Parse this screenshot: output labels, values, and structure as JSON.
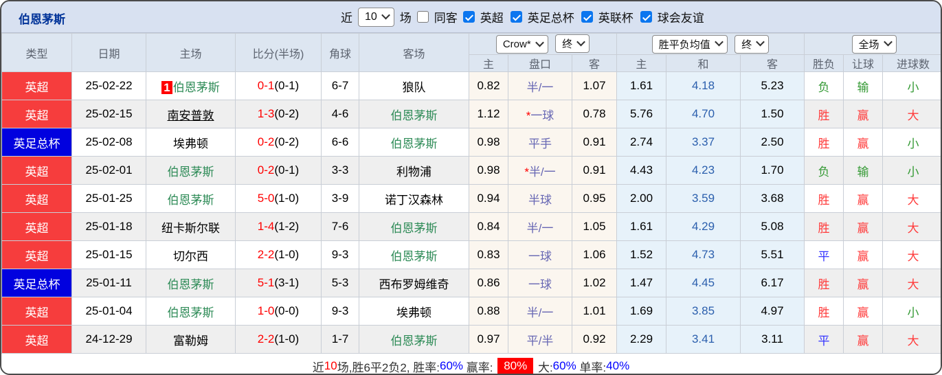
{
  "title": "伯恩茅斯",
  "colors": {
    "topbar_bg": "#d8e1f1",
    "header_bg": "#dde6f1",
    "title_blue": "#003399",
    "league_red": "#f63d3d",
    "league_blue": "#0101df",
    "self_green": "#2e8b57",
    "score_red": "#ff0000",
    "handicap_col": "#6666b3",
    "avg_blue": "#2b5fad",
    "win_red": "#ff3a3a",
    "lose_green": "#339933",
    "draw_blue": "#3333ff",
    "pct_blue": "#0000ff",
    "checkbox_blue": "#0b76ef",
    "odds_bg": "#fbf6ef",
    "avg_bg": "#e7f2fa"
  },
  "topbar": {
    "recent_label": "近",
    "recent_select": "10",
    "games_label": "场",
    "same_opponent": {
      "label": "同客",
      "checked": false
    },
    "league_filters": [
      {
        "label": "英超",
        "checked": true
      },
      {
        "label": "英足总杯",
        "checked": true
      },
      {
        "label": "英联杯",
        "checked": true
      },
      {
        "label": "球会友谊",
        "checked": true
      }
    ]
  },
  "header": {
    "left_columns": [
      "类型",
      "日期",
      "主场",
      "比分(半场)",
      "角球",
      "客场"
    ],
    "odds_company_select": "Crow*",
    "odds_time_select": "终",
    "avg_company_select": "胜平负均值",
    "avg_time_select": "终",
    "scope_select": "全场",
    "sub_columns": [
      "主",
      "盘口",
      "客",
      "主",
      "和",
      "客",
      "胜负",
      "让球",
      "进球数"
    ]
  },
  "rows": [
    {
      "league": "英超",
      "lc": "red",
      "date": "25-02-22",
      "home": {
        "name": "伯恩茅斯",
        "self": true,
        "badge": "1"
      },
      "score": "0-1",
      "half": "(0-1)",
      "corner": "6-7",
      "away": {
        "name": "狼队"
      },
      "odds": [
        "0.82",
        "半/一",
        "1.07"
      ],
      "star": false,
      "avg": [
        "1.61",
        "4.18",
        "5.23"
      ],
      "result": {
        "t": "负",
        "c": "green"
      },
      "let": {
        "t": "输",
        "c": "green"
      },
      "goal": {
        "t": "小",
        "c": "green"
      }
    },
    {
      "league": "英超",
      "lc": "red",
      "date": "25-02-15",
      "home": {
        "name": "南安普敦",
        "link": true
      },
      "score": "1-3",
      "half": "(0-2)",
      "corner": "4-6",
      "away": {
        "name": "伯恩茅斯",
        "self": true
      },
      "odds": [
        "1.12",
        "一球",
        "0.78"
      ],
      "star": true,
      "avg": [
        "5.76",
        "4.70",
        "1.50"
      ],
      "result": {
        "t": "胜",
        "c": "red"
      },
      "let": {
        "t": "赢",
        "c": "red"
      },
      "goal": {
        "t": "大",
        "c": "red"
      }
    },
    {
      "league": "英足总杯",
      "lc": "blue",
      "date": "25-02-08",
      "home": {
        "name": "埃弗顿"
      },
      "score": "0-2",
      "half": "(0-2)",
      "corner": "6-6",
      "away": {
        "name": "伯恩茅斯",
        "self": true
      },
      "odds": [
        "0.98",
        "平手",
        "0.91"
      ],
      "star": false,
      "avg": [
        "2.74",
        "3.37",
        "2.50"
      ],
      "result": {
        "t": "胜",
        "c": "red"
      },
      "let": {
        "t": "赢",
        "c": "red"
      },
      "goal": {
        "t": "小",
        "c": "green"
      }
    },
    {
      "league": "英超",
      "lc": "red",
      "date": "25-02-01",
      "home": {
        "name": "伯恩茅斯",
        "self": true
      },
      "score": "0-2",
      "half": "(0-1)",
      "corner": "3-3",
      "away": {
        "name": "利物浦"
      },
      "odds": [
        "0.98",
        "半/一",
        "0.91"
      ],
      "star": true,
      "avg": [
        "4.43",
        "4.23",
        "1.70"
      ],
      "result": {
        "t": "负",
        "c": "green"
      },
      "let": {
        "t": "输",
        "c": "green"
      },
      "goal": {
        "t": "小",
        "c": "green"
      }
    },
    {
      "league": "英超",
      "lc": "red",
      "date": "25-01-25",
      "home": {
        "name": "伯恩茅斯",
        "self": true
      },
      "score": "5-0",
      "half": "(1-0)",
      "corner": "3-9",
      "away": {
        "name": "诺丁汉森林"
      },
      "odds": [
        "0.94",
        "半球",
        "0.95"
      ],
      "star": false,
      "avg": [
        "2.00",
        "3.59",
        "3.68"
      ],
      "result": {
        "t": "胜",
        "c": "red"
      },
      "let": {
        "t": "赢",
        "c": "red"
      },
      "goal": {
        "t": "大",
        "c": "red"
      }
    },
    {
      "league": "英超",
      "lc": "red",
      "date": "25-01-18",
      "home": {
        "name": "纽卡斯尔联"
      },
      "score": "1-4",
      "half": "(1-2)",
      "corner": "7-6",
      "away": {
        "name": "伯恩茅斯",
        "self": true
      },
      "odds": [
        "0.84",
        "半/一",
        "1.05"
      ],
      "star": false,
      "avg": [
        "1.61",
        "4.29",
        "5.08"
      ],
      "result": {
        "t": "胜",
        "c": "red"
      },
      "let": {
        "t": "赢",
        "c": "red"
      },
      "goal": {
        "t": "大",
        "c": "red"
      }
    },
    {
      "league": "英超",
      "lc": "red",
      "date": "25-01-15",
      "home": {
        "name": "切尔西"
      },
      "score": "2-2",
      "half": "(1-0)",
      "corner": "9-3",
      "away": {
        "name": "伯恩茅斯",
        "self": true
      },
      "odds": [
        "0.83",
        "一球",
        "1.06"
      ],
      "star": false,
      "avg": [
        "1.52",
        "4.73",
        "5.51"
      ],
      "result": {
        "t": "平",
        "c": "blue"
      },
      "let": {
        "t": "赢",
        "c": "red"
      },
      "goal": {
        "t": "大",
        "c": "red"
      }
    },
    {
      "league": "英足总杯",
      "lc": "blue",
      "date": "25-01-11",
      "home": {
        "name": "伯恩茅斯",
        "self": true
      },
      "score": "5-1",
      "half": "(3-1)",
      "corner": "5-3",
      "away": {
        "name": "西布罗姆维奇"
      },
      "odds": [
        "0.86",
        "一球",
        "1.02"
      ],
      "star": false,
      "avg": [
        "1.47",
        "4.45",
        "6.17"
      ],
      "result": {
        "t": "胜",
        "c": "red"
      },
      "let": {
        "t": "赢",
        "c": "red"
      },
      "goal": {
        "t": "大",
        "c": "red"
      }
    },
    {
      "league": "英超",
      "lc": "red",
      "date": "25-01-04",
      "home": {
        "name": "伯恩茅斯",
        "self": true
      },
      "score": "1-0",
      "half": "(0-0)",
      "corner": "9-3",
      "away": {
        "name": "埃弗顿"
      },
      "odds": [
        "0.88",
        "半/一",
        "1.01"
      ],
      "star": false,
      "avg": [
        "1.69",
        "3.85",
        "4.97"
      ],
      "result": {
        "t": "胜",
        "c": "red"
      },
      "let": {
        "t": "赢",
        "c": "red"
      },
      "goal": {
        "t": "小",
        "c": "green"
      }
    },
    {
      "league": "英超",
      "lc": "red",
      "date": "24-12-29",
      "home": {
        "name": "富勒姆"
      },
      "score": "2-2",
      "half": "(1-0)",
      "corner": "1-7",
      "away": {
        "name": "伯恩茅斯",
        "self": true
      },
      "odds": [
        "0.97",
        "平/半",
        "0.92"
      ],
      "star": false,
      "avg": [
        "2.29",
        "3.41",
        "3.11"
      ],
      "result": {
        "t": "平",
        "c": "blue"
      },
      "let": {
        "t": "赢",
        "c": "red"
      },
      "goal": {
        "t": "大",
        "c": "red"
      }
    }
  ],
  "summary": {
    "segments": [
      {
        "t": "近",
        "s": "plain"
      },
      {
        "t": "10",
        "s": "red"
      },
      {
        "t": "场,胜6平2负2, 胜率:",
        "s": "plain"
      },
      {
        "t": "60%",
        "s": "blue"
      },
      {
        "t": " 赢率: ",
        "s": "plain"
      },
      {
        "t": "80%",
        "s": "badge"
      },
      {
        "t": " 大:",
        "s": "plain"
      },
      {
        "t": "60%",
        "s": "blue"
      },
      {
        "t": " 单率:",
        "s": "plain"
      },
      {
        "t": "40%",
        "s": "blue"
      }
    ]
  }
}
